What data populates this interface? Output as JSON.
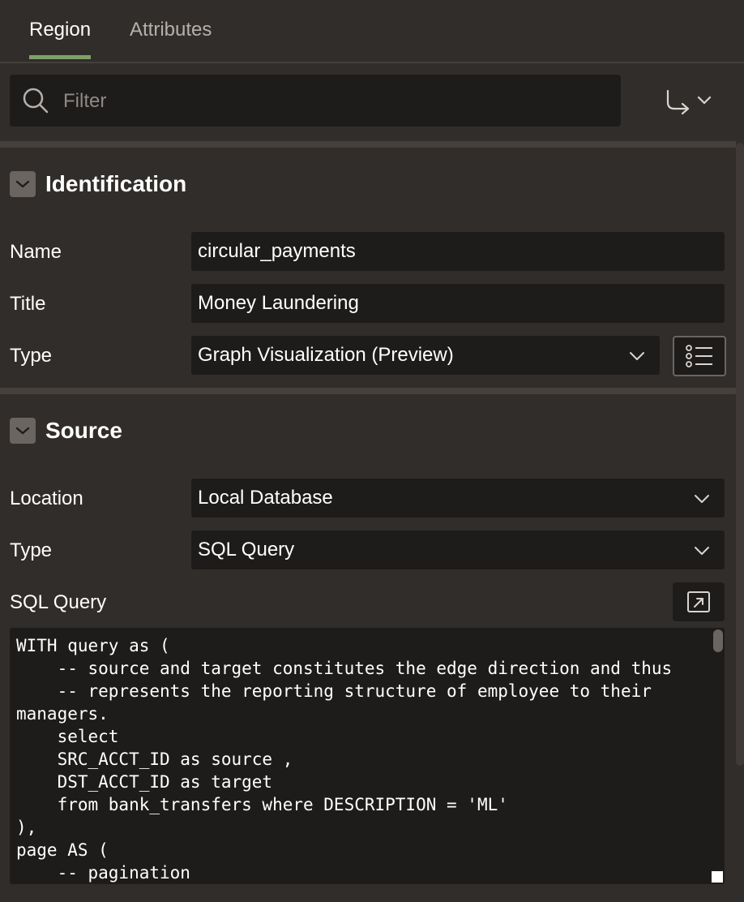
{
  "tabs": [
    {
      "label": "Region"
    },
    {
      "label": "Attributes"
    }
  ],
  "filter": {
    "placeholder": "Filter"
  },
  "identification": {
    "title": "Identification",
    "name_label": "Name",
    "name_value": "circular_payments",
    "title_label": "Title",
    "title_value": "Money Laundering",
    "type_label": "Type",
    "type_value": "Graph Visualization (Preview)"
  },
  "source": {
    "title": "Source",
    "location_label": "Location",
    "location_value": "Local Database",
    "type_label": "Type",
    "type_value": "SQL Query",
    "sql_label": "SQL Query",
    "sql_code": "WITH query as (\n    -- source and target constitutes the edge direction and thus\n    -- represents the reporting structure of employee to their\nmanagers.\n    select\n    SRC_ACCT_ID as source ,\n    DST_ACCT_ID as target\n    from bank_transfers where DESCRIPTION = 'ML'\n),\npage AS (\n    -- pagination"
  },
  "icons": {
    "search": "search-icon",
    "goto": "return-arrow-icon",
    "chevron": "chevron-down-icon",
    "list": "list-icon",
    "expand": "expand-icon"
  }
}
